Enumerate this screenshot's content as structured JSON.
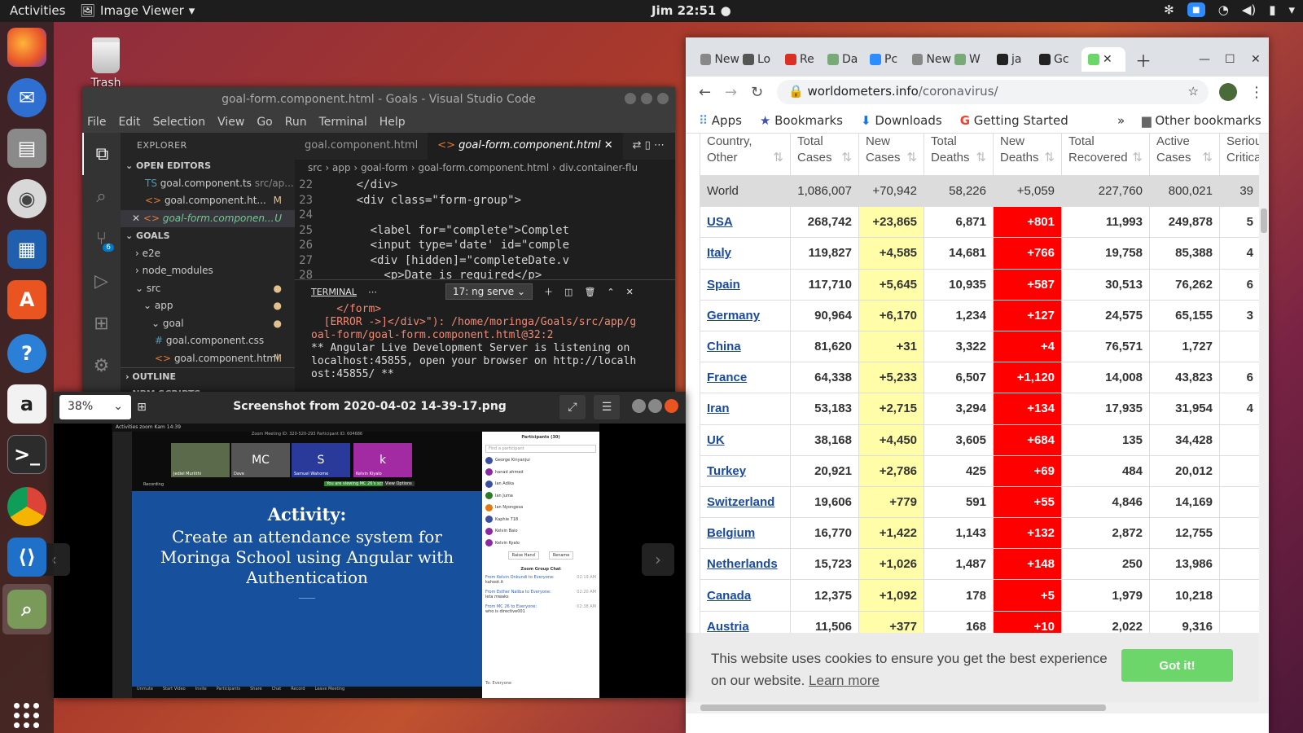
{
  "topbar": {
    "activities": "Activities",
    "app_name": "Image Viewer",
    "clock": "Jim 22:51"
  },
  "desktop": {
    "trash_label": "Trash"
  },
  "vscode": {
    "title": "goal-form.component.html - Goals - Visual Studio Code",
    "menu": [
      "File",
      "Edit",
      "Selection",
      "View",
      "Go",
      "Run",
      "Terminal",
      "Help"
    ],
    "explorer_label": "EXPLORER",
    "open_editors_label": "OPEN EDITORS",
    "open_editors": [
      {
        "name": "goal.component.ts",
        "path": "src/ap..."
      },
      {
        "name": "goal.component.ht...",
        "badge": "M"
      },
      {
        "name": "goal-form.componen...",
        "badge": "U"
      }
    ],
    "goals_label": "GOALS",
    "tree": [
      "e2e",
      "node_modules",
      "src",
      "app",
      "goal",
      "goal.component.css",
      "goal.component.html"
    ],
    "tree_badge": "M",
    "outline_label": "OUTLINE",
    "npm_label": "NPM SCRIPTS",
    "scm_count": "6",
    "tabs": [
      "goal.component.html",
      "goal-form.component.html"
    ],
    "breadcrumb": "src › app › goal-form › goal-form.component.html › div.container-flu",
    "lines": [
      {
        "n": "22",
        "html": "    </div>"
      },
      {
        "n": "23",
        "html": "    <div class=\"form-group\">"
      },
      {
        "n": "24",
        "html": ""
      },
      {
        "n": "25",
        "html": "      <label for=\"complete\">Complet"
      },
      {
        "n": "26",
        "html": "      <input type='date' id=\"comple"
      },
      {
        "n": "27",
        "html": "      <div [hidden]=\"completeDate.v"
      },
      {
        "n": "28",
        "html": "        <p>Date is required</p>"
      }
    ],
    "terminal_label": "TERMINAL",
    "terminal_select": "17: ng serve",
    "terminal_lines": [
      "    </form>",
      "  [ERROR ->]</div>\"): /home/moringa/Goals/src/app/g",
      "oal-form/goal-form.component.html@32:2",
      "** Angular Live Development Server is listening on",
      "localhost:45855, open your browser on http://localh",
      "ost:45855/ **"
    ]
  },
  "imageviewer": {
    "zoom": "38%",
    "title": "Screenshot from 2020-04-02 14-39-17.png",
    "shot": {
      "topbar": "Activities   zoom   Kam 14:39",
      "meeting_id": "Zoom Meeting ID: 320-520-293 Participant ID: 604686",
      "tiles": [
        "Jediel Muriithi",
        "Dave",
        "Samuel Wahome",
        "Kelvin Kiyalo"
      ],
      "tile_letters": [
        "MC",
        "S",
        "k"
      ],
      "recording": "Recording",
      "viewing": "You are viewing MC 26's screen",
      "view_options": "View Options",
      "slide_heading": "Activity:",
      "slide_body": "Create an attendance system for Moringa School using Angular with Authentication",
      "participants_title": "Participants (30)",
      "find": "Find a participant",
      "participants": [
        "George Kinyanjui",
        "hanad ahmed",
        "Ian Adika",
        "Ian Juma",
        "Ian Nyongesa",
        "Kaphie 718",
        "Kelvin Baio",
        "Kelvin Kyalo"
      ],
      "raise_hand": "Raise Hand",
      "rename": "Rename",
      "chat_title": "Zoom Group Chat",
      "chat": [
        {
          "from": "From Kelvin Onkundi to Everyone:",
          "msg": "kahoot.it",
          "time": "02:19 AM"
        },
        {
          "from": "From Esther Naliba to Everyone:",
          "msg": "leta mwaks",
          "time": "02:20 AM"
        },
        {
          "from": "From MC 26 to Everyone:",
          "msg": "who is directive001",
          "time": "02:38 AM"
        }
      ],
      "to": "To:  Everyone",
      "bottom": [
        "Unmute",
        "Start Video",
        "Invite",
        "Participants",
        "Share",
        "Chat",
        "Record",
        "Leave Meeting"
      ]
    }
  },
  "browser": {
    "tabs": [
      "New",
      "Lo",
      "Re",
      "Da",
      "Pc",
      "New",
      "W",
      "ja",
      "Gc"
    ],
    "url_host": "worldometers.info",
    "url_path": "/coronavirus/",
    "bookmarks": [
      "Apps",
      "Bookmarks",
      "Downloads",
      "Getting Started"
    ],
    "other_bookmarks": "Other bookmarks",
    "headers": [
      [
        "Country,",
        "Other"
      ],
      [
        "Total",
        "Cases"
      ],
      [
        "New",
        "Cases"
      ],
      [
        "Total",
        "Deaths"
      ],
      [
        "New",
        "Deaths"
      ],
      [
        "Total",
        "Recovered"
      ],
      [
        "Active",
        "Cases"
      ],
      [
        "Seriou",
        "Critica"
      ]
    ],
    "rows": [
      [
        "World",
        "1,086,007",
        "+70,942",
        "58,226",
        "+5,059",
        "227,760",
        "800,021",
        "39"
      ],
      [
        "USA",
        "268,742",
        "+23,865",
        "6,871",
        "+801",
        "11,993",
        "249,878",
        "5"
      ],
      [
        "Italy",
        "119,827",
        "+4,585",
        "14,681",
        "+766",
        "19,758",
        "85,388",
        "4"
      ],
      [
        "Spain",
        "117,710",
        "+5,645",
        "10,935",
        "+587",
        "30,513",
        "76,262",
        "6"
      ],
      [
        "Germany",
        "90,964",
        "+6,170",
        "1,234",
        "+127",
        "24,575",
        "65,155",
        "3"
      ],
      [
        "China",
        "81,620",
        "+31",
        "3,322",
        "+4",
        "76,571",
        "1,727",
        ""
      ],
      [
        "France",
        "64,338",
        "+5,233",
        "6,507",
        "+1,120",
        "14,008",
        "43,823",
        "6"
      ],
      [
        "Iran",
        "53,183",
        "+2,715",
        "3,294",
        "+134",
        "17,935",
        "31,954",
        "4"
      ],
      [
        "UK",
        "38,168",
        "+4,450",
        "3,605",
        "+684",
        "135",
        "34,428",
        ""
      ],
      [
        "Turkey",
        "20,921",
        "+2,786",
        "425",
        "+69",
        "484",
        "20,012",
        ""
      ],
      [
        "Switzerland",
        "19,606",
        "+779",
        "591",
        "+55",
        "4,846",
        "14,169",
        ""
      ],
      [
        "Belgium",
        "16,770",
        "+1,422",
        "1,143",
        "+132",
        "2,872",
        "12,755",
        ""
      ],
      [
        "Netherlands",
        "15,723",
        "+1,026",
        "1,487",
        "+148",
        "250",
        "13,986",
        ""
      ],
      [
        "Canada",
        "12,375",
        "+1,092",
        "178",
        "+5",
        "1,979",
        "10,218",
        ""
      ],
      [
        "Austria",
        "11,506",
        "+377",
        "168",
        "+10",
        "2,022",
        "9,316",
        ""
      ]
    ],
    "cookie_text": "This website uses cookies to ensure you get the best experience on our website.",
    "cookie_link": "Learn more",
    "cookie_button": "Got it!"
  }
}
